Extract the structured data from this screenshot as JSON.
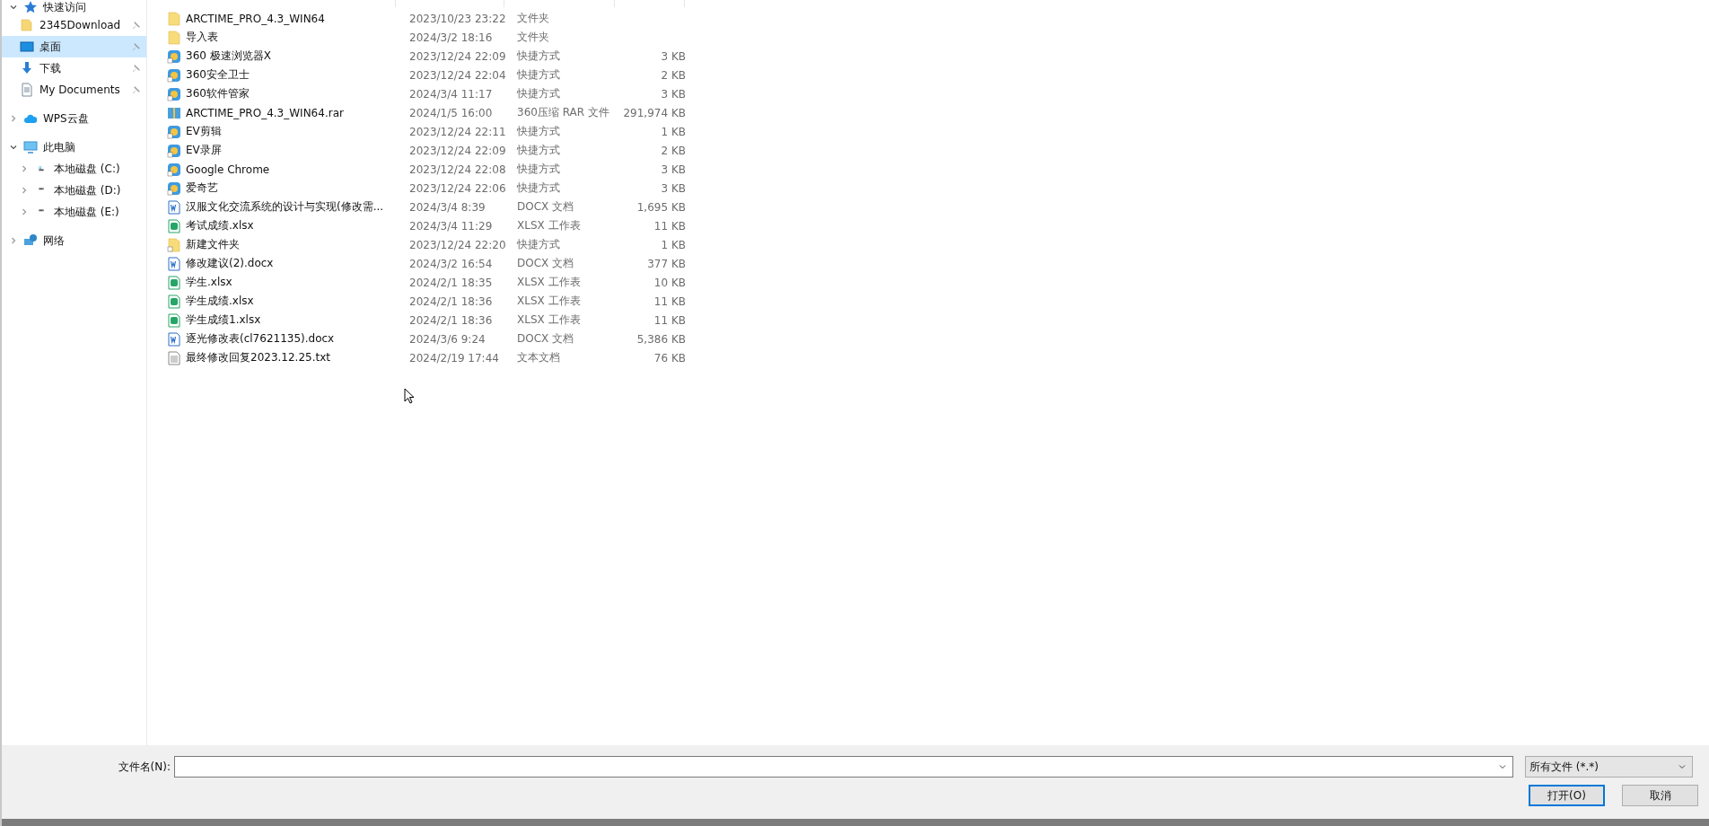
{
  "sidebar": {
    "items": [
      {
        "label": "快速访问",
        "kind": "star",
        "expanded": true,
        "children": [
          {
            "label": "2345Download",
            "kind": "folder",
            "pinned": true,
            "selected": false
          },
          {
            "label": "桌面",
            "kind": "desktop",
            "pinned": true,
            "selected": true
          },
          {
            "label": "下载",
            "kind": "download",
            "pinned": true,
            "selected": false
          },
          {
            "label": "My Documents",
            "kind": "document",
            "pinned": true,
            "selected": false
          }
        ]
      },
      {
        "label": "WPS云盘",
        "kind": "cloud",
        "expanded": false
      },
      {
        "label": "此电脑",
        "kind": "computer",
        "expanded": true,
        "children": [
          {
            "label": "本地磁盘 (C:)",
            "kind": "system-drive",
            "expanded": false
          },
          {
            "label": "本地磁盘 (D:)",
            "kind": "drive",
            "expanded": false
          },
          {
            "label": "本地磁盘 (E:)",
            "kind": "drive",
            "expanded": false
          }
        ]
      },
      {
        "label": "网络",
        "kind": "network",
        "expanded": false
      }
    ]
  },
  "files": [
    {
      "name": "ARCTIME_PRO_4.3_WIN64",
      "date": "2023/10/23 23:22",
      "type": "文件夹",
      "kind": "folder"
    },
    {
      "name": "导入表",
      "date": "2024/3/2 18:16",
      "type": "文件夹",
      "kind": "folder"
    },
    {
      "name": "360 极速浏览器X",
      "date": "2023/12/24 22:09",
      "type": "快捷方式",
      "size": "3 KB",
      "kind": "app"
    },
    {
      "name": "360安全卫士",
      "date": "2023/12/24 22:04",
      "type": "快捷方式",
      "size": "2 KB",
      "kind": "app"
    },
    {
      "name": "360软件管家",
      "date": "2024/3/4 11:17",
      "type": "快捷方式",
      "size": "3 KB",
      "kind": "app"
    },
    {
      "name": "ARCTIME_PRO_4.3_WIN64.rar",
      "date": "2024/1/5 16:00",
      "type": "360压缩 RAR 文件",
      "size": "291,974 KB",
      "kind": "archive"
    },
    {
      "name": "EV剪辑",
      "date": "2023/12/24 22:11",
      "type": "快捷方式",
      "size": "1 KB",
      "kind": "app"
    },
    {
      "name": "EV录屏",
      "date": "2023/12/24 22:09",
      "type": "快捷方式",
      "size": "2 KB",
      "kind": "app"
    },
    {
      "name": "Google Chrome",
      "date": "2023/12/24 22:08",
      "type": "快捷方式",
      "size": "3 KB",
      "kind": "app"
    },
    {
      "name": "爱奇艺",
      "date": "2023/12/24 22:06",
      "type": "快捷方式",
      "size": "3 KB",
      "kind": "app"
    },
    {
      "name": "汉服文化交流系统的设计与实现(修改需...",
      "date": "2024/3/4 8:39",
      "type": "DOCX 文档",
      "size": "1,695 KB",
      "kind": "docx"
    },
    {
      "name": "考试成绩.xlsx",
      "date": "2024/3/4 11:29",
      "type": "XLSX 工作表",
      "size": "11 KB",
      "kind": "xlsx"
    },
    {
      "name": "新建文件夹",
      "date": "2023/12/24 22:20",
      "type": "快捷方式",
      "size": "1 KB",
      "kind": "folder-shortcut"
    },
    {
      "name": "修改建议(2).docx",
      "date": "2024/3/2 16:54",
      "type": "DOCX 文档",
      "size": "377 KB",
      "kind": "docx"
    },
    {
      "name": "学生.xlsx",
      "date": "2024/2/1 18:35",
      "type": "XLSX 工作表",
      "size": "10 KB",
      "kind": "xlsx"
    },
    {
      "name": "学生成绩.xlsx",
      "date": "2024/2/1 18:36",
      "type": "XLSX 工作表",
      "size": "11 KB",
      "kind": "xlsx"
    },
    {
      "name": "学生成绩1.xlsx",
      "date": "2024/2/1 18:36",
      "type": "XLSX 工作表",
      "size": "11 KB",
      "kind": "xlsx"
    },
    {
      "name": "逐光修改表(cl7621135).docx",
      "date": "2024/3/6 9:24",
      "type": "DOCX 文档",
      "size": "5,386 KB",
      "kind": "docx"
    },
    {
      "name": "最终修改回复2023.12.25.txt",
      "date": "2024/2/19 17:44",
      "type": "文本文档",
      "size": "76 KB",
      "kind": "txt"
    }
  ],
  "footer": {
    "filename_label": "文件名(N):",
    "filter": "所有文件 (*.*)",
    "buttons": [
      {
        "label": "打开(O)",
        "kind": "primary"
      },
      {
        "label": "取消",
        "kind": "normal"
      }
    ]
  }
}
